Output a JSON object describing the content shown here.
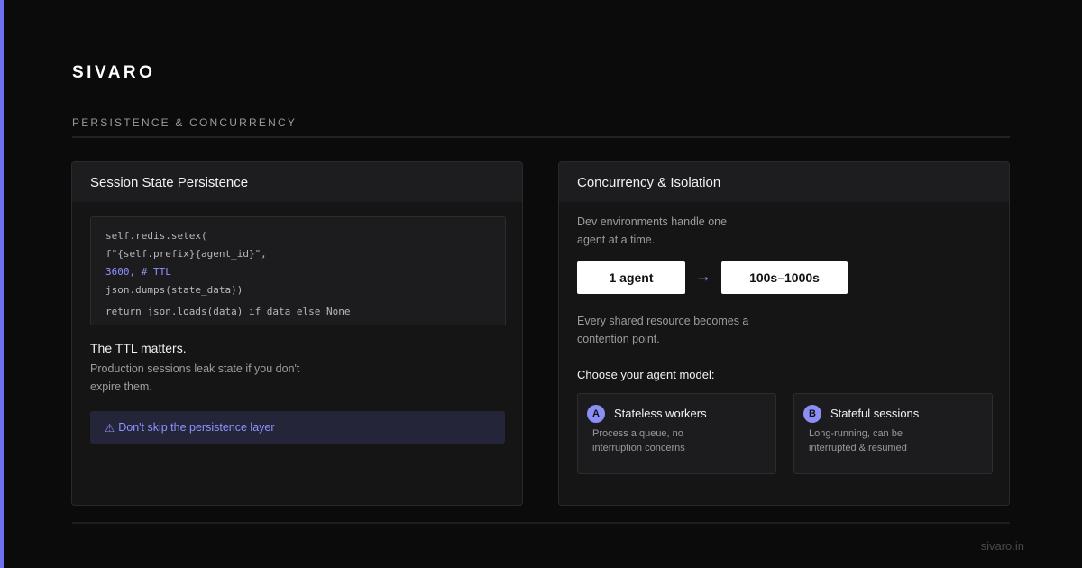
{
  "brand": "SIVARO",
  "section_label": "PERSISTENCE & CONCURRENCY",
  "colors": {
    "accent": "#6f72f0",
    "background": "#0b0b0b",
    "card": "#151516",
    "highlight_text": "#8f93ff"
  },
  "left_card": {
    "title": "Session State Persistence",
    "code_lines": [
      "self.redis.setex(",
      "f\"{self.prefix}{agent_id}\",",
      "3600, # TTL",
      "json.dumps(state_data))",
      "return json.loads(data) if data else None"
    ],
    "ttl_heading": "The TTL matters.",
    "ttl_text": "Production sessions leak state if you don't expire them.",
    "warning_icon": "⚠",
    "warning_text": "Don't skip the persistence layer"
  },
  "right_card": {
    "title": "Concurrency & Isolation",
    "dev_text": "Dev environments handle one agent at a time.",
    "scale_from": "1 agent",
    "scale_arrow": "→",
    "scale_to": "100s–1000s",
    "contention_text": "Every shared resource becomes a contention point.",
    "choose_label": "Choose your agent model:",
    "options": [
      {
        "badge": "A",
        "title": "Stateless workers",
        "description": "Process a queue, no interruption concerns"
      },
      {
        "badge": "B",
        "title": "Stateful sessions",
        "description": "Long-running, can be interrupted & resumed"
      }
    ]
  },
  "footer_url": "sivaro.in"
}
